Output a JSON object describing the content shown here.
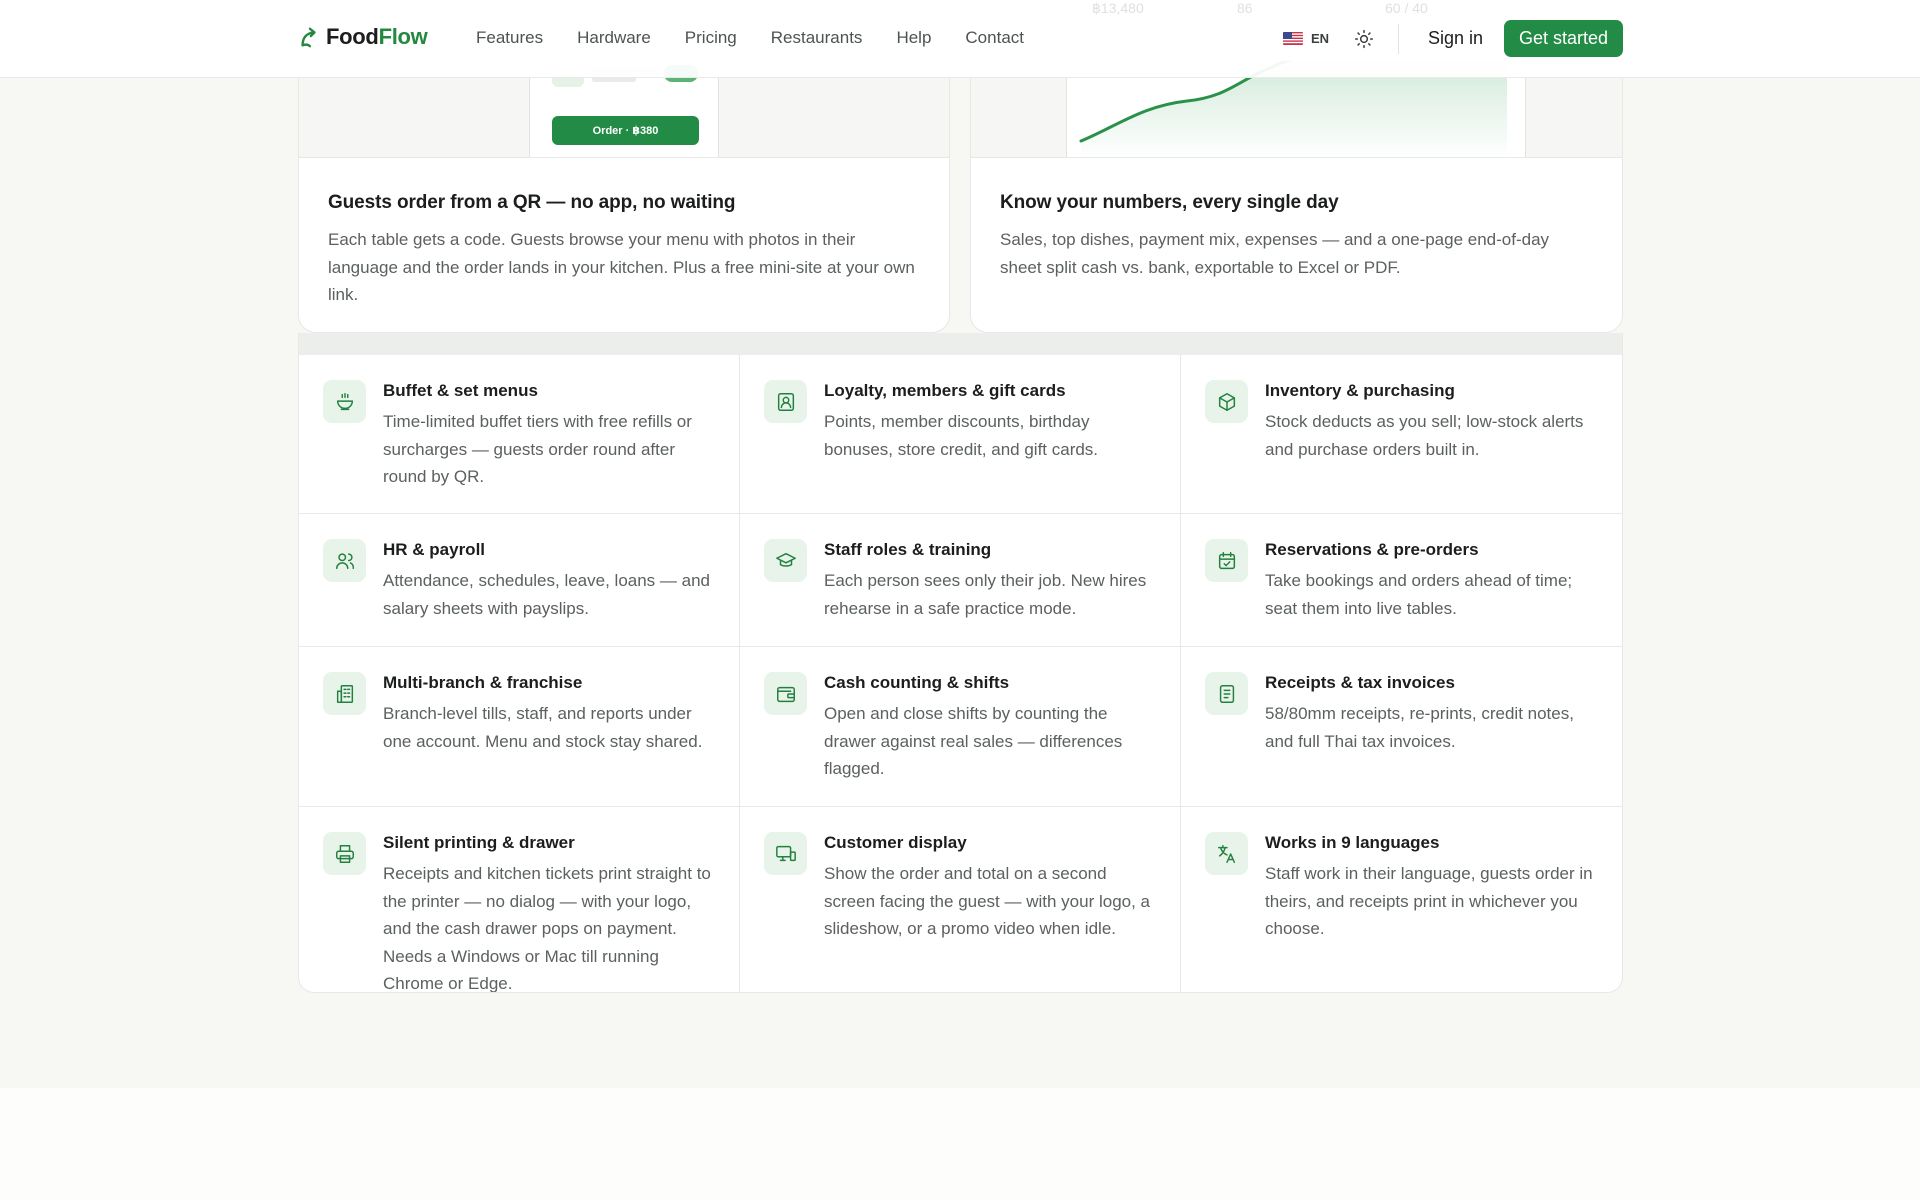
{
  "brand": {
    "name_part1": "Food",
    "name_part2": "Flow",
    "accent": "#228b45",
    "logo_icon": "leaf-arrow-icon"
  },
  "nav": {
    "links": [
      "Features",
      "Hardware",
      "Pricing",
      "Restaurants",
      "Help",
      "Contact"
    ],
    "language": {
      "flag_icon": "us-flag-icon",
      "code": "EN"
    },
    "theme_icon": "sun-icon",
    "signin_label": "Sign in",
    "cta_label": "Get started"
  },
  "cards": [
    {
      "preview": {
        "order_button": "Order · ฿380"
      },
      "title": "Guests order from a QR — no app, no waiting",
      "description": "Each table gets a code. Guests browse your menu with photos in their language and the order lands in your kitchen. Plus a free mini-site at your own link."
    },
    {
      "preview": {
        "stat_labels": [
          "฿13,480",
          "86",
          "60 / 40"
        ]
      },
      "title": "Know your numbers, every single day",
      "description": "Sales, top dishes, payment mix, expenses — and a one-page end-of-day sheet split cash vs. bank, exportable to Excel or PDF."
    }
  ],
  "features": [
    {
      "icon": "bowl-icon",
      "title": "Buffet & set menus",
      "description": "Time-limited buffet tiers with free refills or surcharges — guests order round after round by QR."
    },
    {
      "icon": "member-card-icon",
      "title": "Loyalty, members & gift cards",
      "description": "Points, member discounts, birthday bonuses, store credit, and gift cards."
    },
    {
      "icon": "box-icon",
      "title": "Inventory & purchasing",
      "description": "Stock deducts as you sell; low-stock alerts and purchase orders built in."
    },
    {
      "icon": "users-icon",
      "title": "HR & payroll",
      "description": "Attendance, schedules, leave, loans — and salary sheets with payslips."
    },
    {
      "icon": "graduation-cap-icon",
      "title": "Staff roles & training",
      "description": "Each person sees only their job. New hires rehearse in a safe practice mode."
    },
    {
      "icon": "calendar-check-icon",
      "title": "Reservations & pre-orders",
      "description": "Take bookings and orders ahead of time; seat them into live tables."
    },
    {
      "icon": "buildings-icon",
      "title": "Multi-branch & franchise",
      "description": "Branch-level tills, staff, and reports under one account. Menu and stock stay shared."
    },
    {
      "icon": "wallet-icon",
      "title": "Cash counting & shifts",
      "description": "Open and close shifts by counting the drawer against real sales — differences flagged."
    },
    {
      "icon": "receipt-icon",
      "title": "Receipts & tax invoices",
      "description": "58/80mm receipts, re-prints, credit notes, and full Thai tax invoices."
    },
    {
      "icon": "printer-icon",
      "title": "Silent printing & drawer",
      "description": "Receipts and kitchen tickets print straight to the printer — no dialog — with your logo, and the cash drawer pops on payment. Needs a Windows or Mac till running Chrome or Edge."
    },
    {
      "icon": "monitor-display-icon",
      "title": "Customer display",
      "description": "Show the order and total on a second screen facing the guest — with your logo, a slideshow, or a promo video when idle."
    },
    {
      "icon": "translate-icon",
      "title": "Works in 9 languages",
      "description": "Staff work in their language, guests order in theirs, and receipts print in whichever you choose."
    }
  ]
}
